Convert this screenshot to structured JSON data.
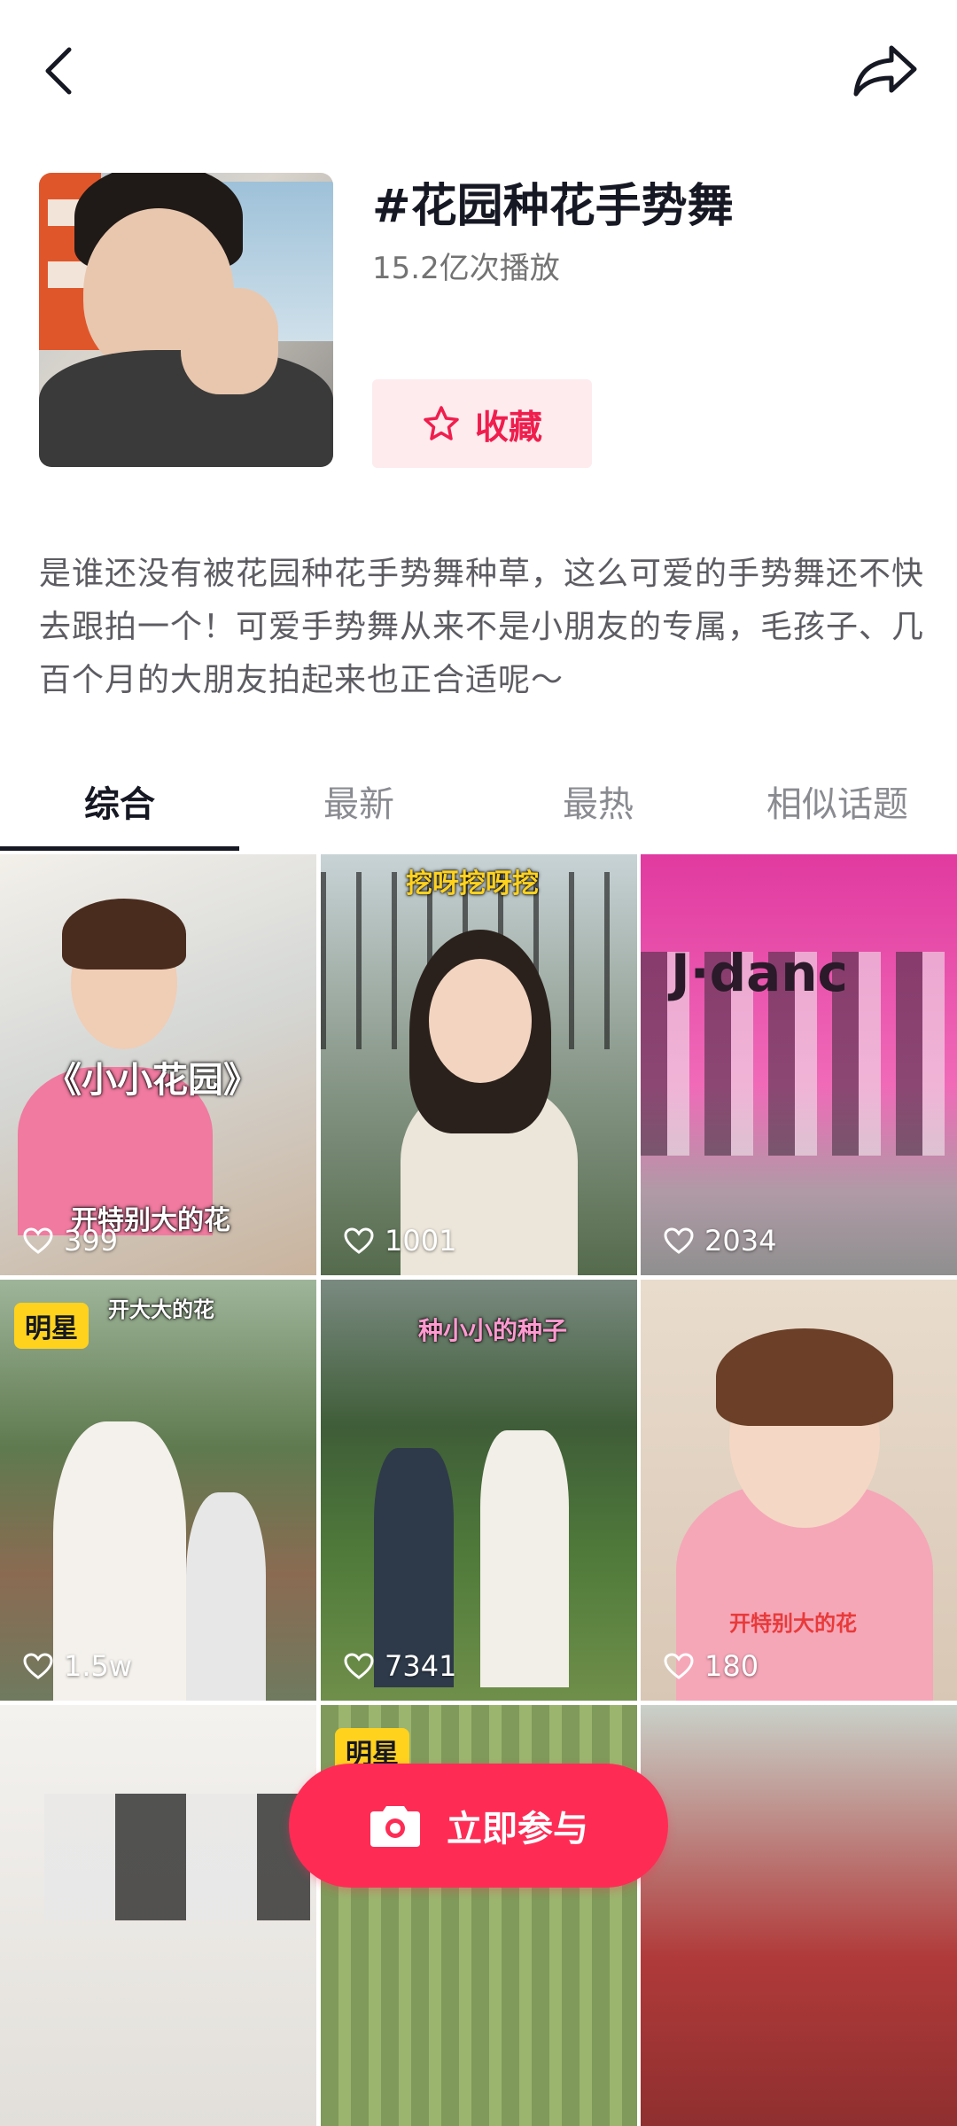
{
  "topbar": {
    "back_icon": "chevron-left-icon",
    "share_icon": "share-arrow-icon"
  },
  "topic": {
    "title": "#花园种花手势舞",
    "plays": "15.2亿次播放",
    "favorite_label": "收藏",
    "description": "是谁还没有被花园种花手势舞种草，这么可爱的手势舞还不快去跟拍一个！可爱手势舞从来不是小朋友的专属，毛孩子、几百个月的大朋友拍起来也正合适呢～"
  },
  "tabs": [
    {
      "label": "综合",
      "active": true
    },
    {
      "label": "最新",
      "active": false
    },
    {
      "label": "最热",
      "active": false
    },
    {
      "label": "相似话题",
      "active": false
    }
  ],
  "videos": [
    {
      "likes": "399",
      "badge": "",
      "caption_top": "《小小花园》",
      "caption_bottom": "开特别大的花"
    },
    {
      "likes": "1001",
      "badge": "",
      "caption_top": "挖呀挖呀挖",
      "caption_bottom": ""
    },
    {
      "likes": "2034",
      "badge": "",
      "caption_top": "J·danc",
      "caption_bottom": ""
    },
    {
      "likes": "1.5w",
      "badge": "明星",
      "caption_top": "开大大的花",
      "caption_bottom": ""
    },
    {
      "likes": "7341",
      "badge": "",
      "caption_top": "种小小的种子",
      "caption_bottom": ""
    },
    {
      "likes": "180",
      "badge": "",
      "caption_top": "",
      "caption_bottom": "开特别大的花"
    },
    {
      "likes": "",
      "badge": "",
      "caption_top": "",
      "caption_bottom": ""
    },
    {
      "likes": "",
      "badge": "明星",
      "caption_top": "",
      "caption_bottom": ""
    },
    {
      "likes": "",
      "badge": "",
      "caption_top": "",
      "caption_bottom": ""
    }
  ],
  "join_button": {
    "label": "立即参与",
    "icon": "camera-icon"
  },
  "colors": {
    "accent": "#fe2c55",
    "favorite_bg": "#fdebee",
    "favorite_text": "#f01e4d",
    "badge": "#ffd21e"
  }
}
